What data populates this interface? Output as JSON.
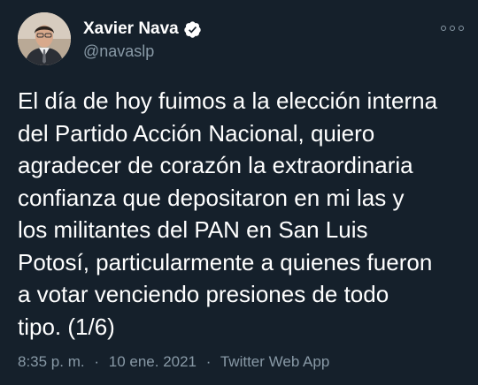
{
  "author": {
    "display_name": "Xavier Nava",
    "handle": "@navaslp",
    "verified_icon": "verified-badge-icon",
    "avatar_icon": "profile-photo"
  },
  "more_icon": "more-options-icon",
  "tweet": {
    "lines": [
      "El día de hoy fuimos a la elección interna",
      "del Partido Acción Nacional, quiero",
      "agradecer de corazón la extraordinaria",
      "confianza que depositaron en mi las y",
      "los militantes del PAN en San Luis",
      "Potosí, particularmente a quienes fueron",
      "a votar venciendo presiones de todo",
      "tipo. (1/6)"
    ]
  },
  "meta": {
    "time": "8:35 p. m.",
    "separator": "·",
    "date": "10 ene. 2021",
    "source": "Twitter Web App"
  },
  "colors": {
    "background": "#15202b",
    "text": "#ffffff",
    "secondary": "#8899a6"
  }
}
